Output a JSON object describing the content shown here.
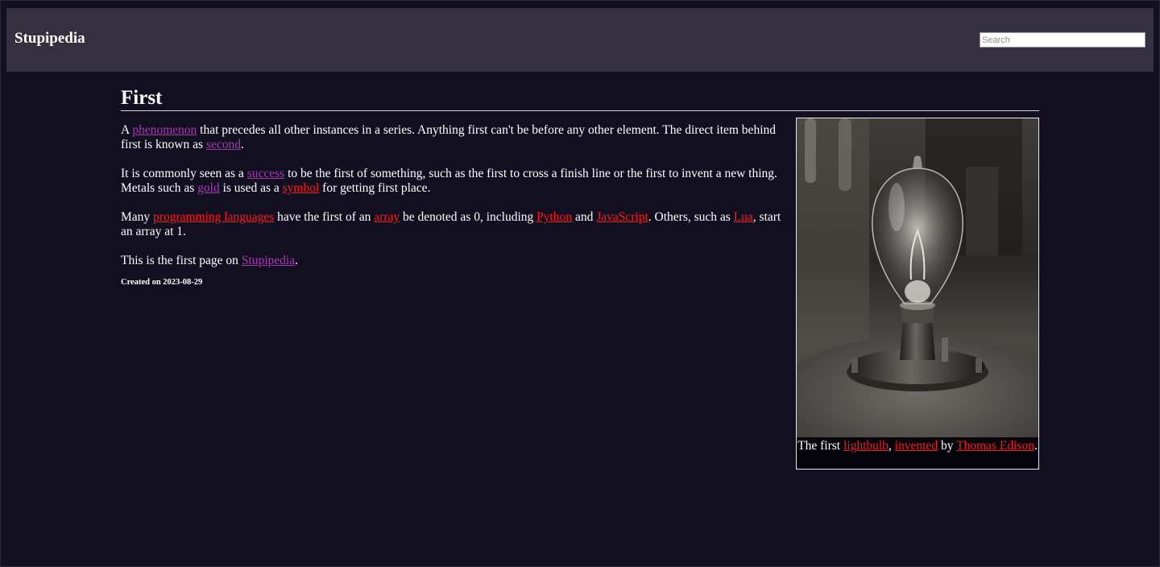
{
  "header": {
    "site_title": "Stupipedia",
    "search_placeholder": "Search",
    "search_value": ""
  },
  "article": {
    "title": "First",
    "paragraphs": [
      {
        "p1_a": "A ",
        "link_phenomenon": "phenomenon",
        "p1_b": " that precedes all other instances in a series. Anything first can't be before any other element. The direct item behind first is known as ",
        "link_second": "second",
        "p1_c": "."
      },
      {
        "p2_a": "It is commonly seen as a ",
        "link_success": "success",
        "p2_b": " to be the first of something, such as the first to cross a finish line or the first to invent a new thing. Metals such as ",
        "link_gold": "gold",
        "p2_c": " is used as a ",
        "link_symbol": "symbol",
        "p2_d": " for getting first place."
      },
      {
        "p3_a": "Many ",
        "link_programming_languages": "programming languages",
        "p3_b": " have the first of an ",
        "link_array": "array",
        "p3_c": " be denoted as 0, including ",
        "link_python": "Python",
        "p3_d": " and ",
        "link_javascript": "JavaScript",
        "p3_e": ". Others, such as ",
        "link_lua": "Lua",
        "p3_f": ", start an array at 1."
      },
      {
        "p4_a": "This is the first page on ",
        "link_stupipedia": "Stupipedia",
        "p4_b": "."
      }
    ],
    "created": "Created on 2023-08-29"
  },
  "figure": {
    "image_icon": "lightbulb-photo",
    "caption": {
      "c_a": "The first ",
      "link_lightbulb": "lightbulb",
      "c_b": ", ",
      "link_invented": "invented",
      "c_c": " by ",
      "link_thomas_edison": "Thomas Edison",
      "c_d": "."
    }
  },
  "colors": {
    "background": "#120f20",
    "header": "#35303f",
    "visited_link": "#a43cb0",
    "missing_link": "#ff1a1a",
    "text": "#ffffff"
  }
}
